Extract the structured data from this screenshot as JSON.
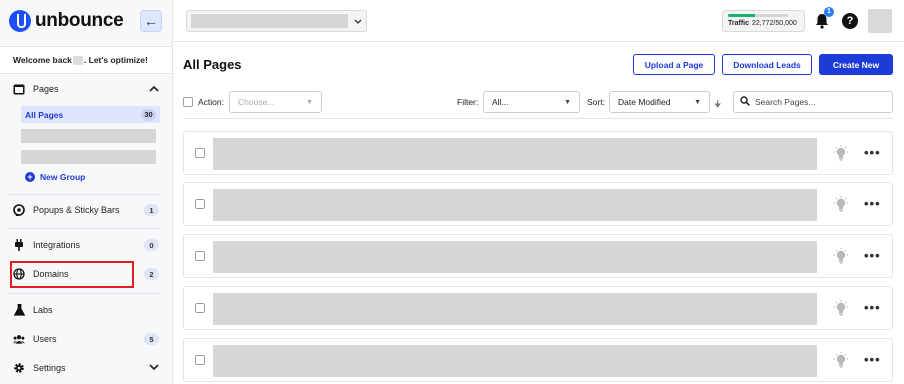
{
  "brand": {
    "name": "unbounce",
    "accent": "#1d3bd6"
  },
  "sidebar": {
    "welcome_prefix": "Welcome back",
    "welcome_suffix": ". Let's optimize!",
    "pages_label": "Pages",
    "all_pages_label": "All Pages",
    "all_pages_count": "30",
    "new_group_label": "New Group",
    "items": [
      {
        "label": "Popups & Sticky Bars",
        "count": "1",
        "icon": "popup-icon"
      },
      {
        "label": "Integrations",
        "count": "0",
        "icon": "plug-icon"
      },
      {
        "label": "Domains",
        "count": "2",
        "icon": "globe-icon"
      },
      {
        "label": "Labs",
        "icon": "flask-icon"
      },
      {
        "label": "Users",
        "count": "5",
        "icon": "users-icon"
      },
      {
        "label": "Settings",
        "icon": "gear-icon"
      }
    ]
  },
  "topbar": {
    "traffic_label": "Traffic",
    "traffic_value": "22,772/50,000",
    "traffic_fraction": 0.455,
    "notification_count": "1",
    "help_label": "?"
  },
  "main": {
    "title": "All Pages",
    "upload_label": "Upload a Page",
    "download_label": "Download Leads",
    "create_label": "Create New",
    "action_label": "Action:",
    "action_placeholder": "Choose...",
    "filter_label": "Filter:",
    "filter_value": "All...",
    "sort_label": "Sort:",
    "sort_value": "Date Modified",
    "search_placeholder": "Search Pages..."
  }
}
